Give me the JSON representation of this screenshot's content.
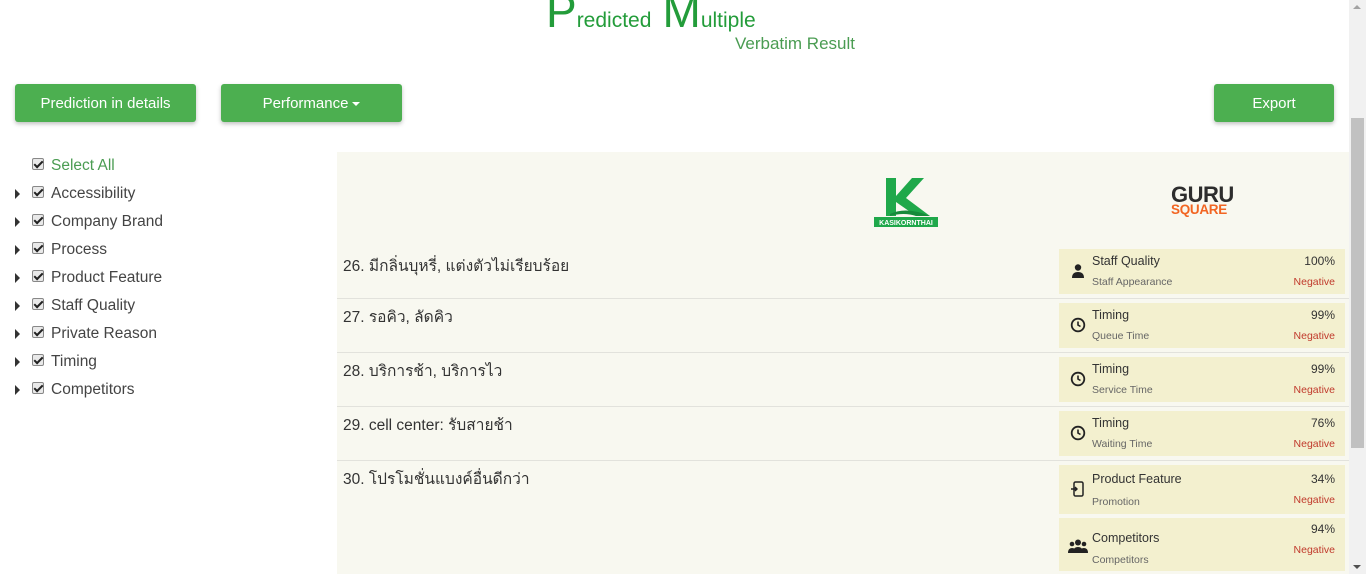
{
  "header": {
    "title_letter_1": "P",
    "title_word_1": "redicted",
    "title_letter_2": "M",
    "title_word_2": "ultiple",
    "subtitle": "Verbatim Result"
  },
  "toolbar": {
    "prediction_label": "Prediction in details",
    "performance_label": "Performance",
    "export_label": "Export"
  },
  "sidebar": {
    "select_all": "Select All",
    "items": [
      {
        "label": "Accessibility"
      },
      {
        "label": "Company Brand"
      },
      {
        "label": "Process"
      },
      {
        "label": "Product Feature"
      },
      {
        "label": "Staff Quality"
      },
      {
        "label": "Private Reason"
      },
      {
        "label": "Timing"
      },
      {
        "label": "Competitors"
      }
    ]
  },
  "logos": {
    "kbank_icon": "kasikornthai-logo",
    "kbank_text": "KASIKORNTHAI",
    "guru_top": "GURU",
    "guru_bottom": "SQUARE"
  },
  "results": [
    {
      "text": "26. มีกลิ่นบุหรี่, แต่งตัวไม่เรียบร้อย",
      "tags": [
        {
          "icon": "user-icon",
          "category": "Staff Quality",
          "subcategory": "Staff Appearance",
          "percent": "100%",
          "sentiment": "Negative"
        }
      ]
    },
    {
      "text": "27. รอคิว, ลัดคิว",
      "tags": [
        {
          "icon": "clock-icon",
          "category": "Timing",
          "subcategory": "Queue Time",
          "percent": "99%",
          "sentiment": "Negative"
        }
      ]
    },
    {
      "text": "28. บริการช้า, บริการไว",
      "tags": [
        {
          "icon": "clock-icon",
          "category": "Timing",
          "subcategory": "Service Time",
          "percent": "99%",
          "sentiment": "Negative"
        }
      ]
    },
    {
      "text": "29. cell center: รับสายช้า",
      "tags": [
        {
          "icon": "clock-icon",
          "category": "Timing",
          "subcategory": "Waiting Time",
          "percent": "76%",
          "sentiment": "Negative"
        }
      ]
    },
    {
      "text": "30. โปรโมชั่นแบงค์อื่นดีกว่า",
      "tags": [
        {
          "icon": "phone-icon",
          "category": "Product Feature",
          "subcategory": "Promotion",
          "percent": "34%",
          "sentiment": "Negative"
        },
        {
          "icon": "group-icon",
          "category": "Competitors",
          "subcategory": "Competitors",
          "percent": "94%",
          "sentiment": "Negative"
        }
      ]
    }
  ],
  "colors": {
    "accent": "#4caf50",
    "title": "#239c3a",
    "negative": "#c0392b",
    "panel_bg": "#f8f8f0",
    "tag_bg": "#f3f0cf"
  }
}
